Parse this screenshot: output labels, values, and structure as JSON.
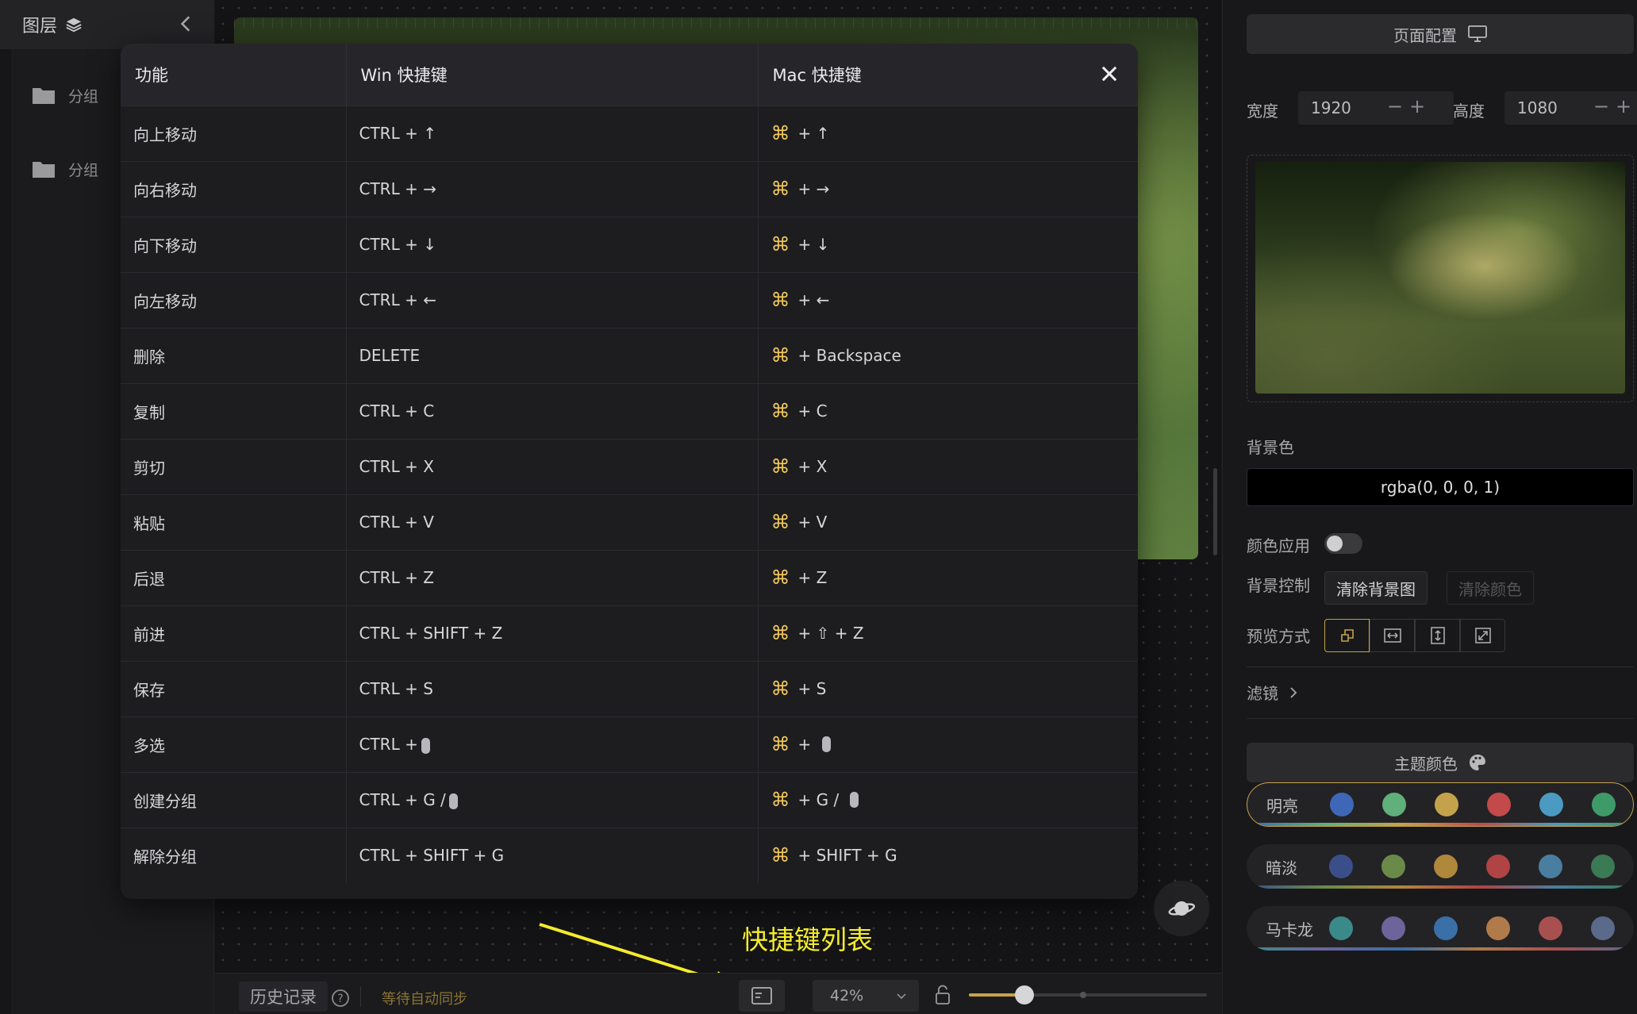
{
  "left_panel": {
    "title": "图层",
    "groups": [
      {
        "label": "分组"
      },
      {
        "label": "分组"
      }
    ]
  },
  "shortcut_modal": {
    "headers": {
      "function": "功能",
      "win": "Win 快捷键",
      "mac": "Mac 快捷键"
    },
    "rows": [
      {
        "func": "向上移动",
        "win": "CTRL + ↑",
        "mac": "+ ↑"
      },
      {
        "func": "向右移动",
        "win": "CTRL + →",
        "mac": "+ →"
      },
      {
        "func": "向下移动",
        "win": "CTRL + ↓",
        "mac": "+ ↓"
      },
      {
        "func": "向左移动",
        "win": "CTRL + ←",
        "mac": "+ ←"
      },
      {
        "func": "删除",
        "win": "DELETE",
        "mac": "+ Backspace"
      },
      {
        "func": "复制",
        "win": "CTRL + C",
        "mac": "+ C"
      },
      {
        "func": "剪切",
        "win": "CTRL + X",
        "mac": "+ X"
      },
      {
        "func": "粘贴",
        "win": "CTRL + V",
        "mac": "+ V"
      },
      {
        "func": "后退",
        "win": "CTRL + Z",
        "mac": "+ Z"
      },
      {
        "func": "前进",
        "win": "CTRL + SHIFT + Z",
        "mac": "+ ⇧ + Z"
      },
      {
        "func": "保存",
        "win": "CTRL + S",
        "mac": "+ S"
      },
      {
        "func": "多选",
        "win": "CTRL +",
        "mac": "+",
        "win_mouse": true,
        "mac_mouse": true
      },
      {
        "func": "创建分组",
        "win": "CTRL + G /",
        "mac": "+ G /",
        "win_mouse": true,
        "mac_mouse": true
      },
      {
        "func": "解除分组",
        "win": "CTRL + SHIFT + G",
        "mac": "+ SHIFT + G"
      }
    ],
    "cmd_symbol": "⌘"
  },
  "annotation": {
    "label": "快捷键列表",
    "color": "#f5ec2c"
  },
  "bottom_bar": {
    "history_label": "历史记录",
    "sync_status": "等待自动同步",
    "zoom_label": "42%",
    "zoom_value": 0.42
  },
  "right_panel": {
    "page_config_label": "页面配置",
    "width_label": "宽度",
    "width_value": "1920",
    "height_label": "高度",
    "height_value": "1080",
    "bg_color_label": "背景色",
    "bg_color_value": "rgba(0, 0, 0, 1)",
    "color_apply_label": "颜色应用",
    "bg_control_label": "背景控制",
    "clear_bg_image": "清除背景图",
    "clear_color": "清除颜色",
    "preview_mode_label": "预览方式",
    "filter_label": "滤镜",
    "theme_color_label": "主题颜色",
    "themes": [
      {
        "name": "明亮",
        "colors": [
          "#3f67b8",
          "#5fb07a",
          "#c4a24c",
          "#c24a4a",
          "#4a9ac2",
          "#3f9a6a"
        ]
      },
      {
        "name": "暗淡",
        "colors": [
          "#3a4f8a",
          "#6a8a4a",
          "#b0883c",
          "#b04444",
          "#4a7ea0",
          "#3a7a55"
        ]
      },
      {
        "name": "马卡龙",
        "colors": [
          "#3a8a8a",
          "#6c649a",
          "#3a6fa8",
          "#b07a4a",
          "#a85050",
          "#5a6a8a"
        ]
      }
    ]
  }
}
